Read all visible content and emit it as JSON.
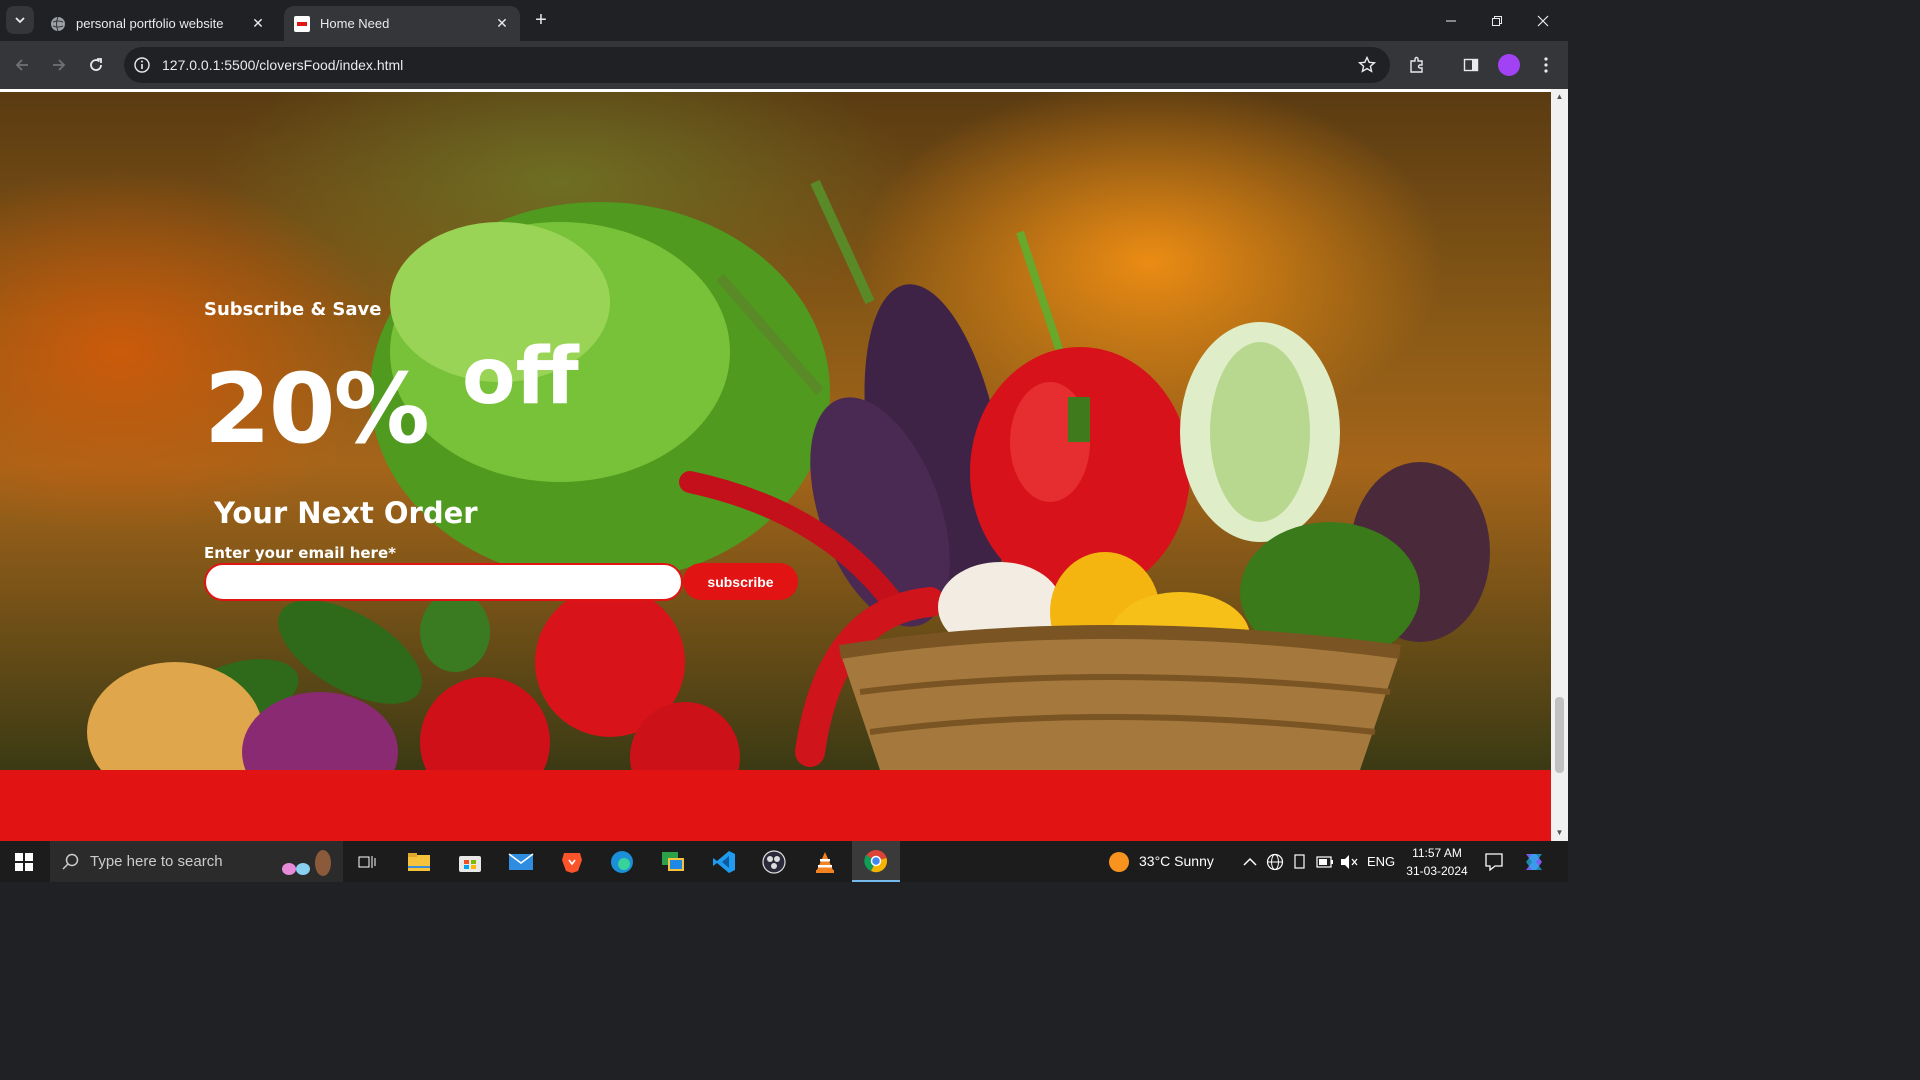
{
  "browser": {
    "tabs": [
      {
        "title": "personal portfolio website",
        "active": false
      },
      {
        "title": "Home Need",
        "active": true
      }
    ],
    "url": "127.0.0.1:5500/cloversFood/index.html"
  },
  "page": {
    "hero": {
      "kicker": "Subscribe & Save",
      "discount": "20%",
      "off": "off",
      "headline": "Your Next Order",
      "email_label": "Enter your email here*",
      "email_value": "",
      "subscribe_label": "subscribe"
    },
    "colors": {
      "brand_red": "#e11313",
      "text_white": "#ffffff"
    }
  },
  "taskbar": {
    "search_placeholder": "Type here to search",
    "apps": [
      "task-view",
      "file-explorer",
      "microsoft-store",
      "mail",
      "brave",
      "edge",
      "chat",
      "vscode",
      "obs",
      "vlc",
      "chrome"
    ],
    "weather": "33°C  Sunny",
    "language": "ENG",
    "time": "11:57 AM",
    "date": "31-03-2024"
  }
}
